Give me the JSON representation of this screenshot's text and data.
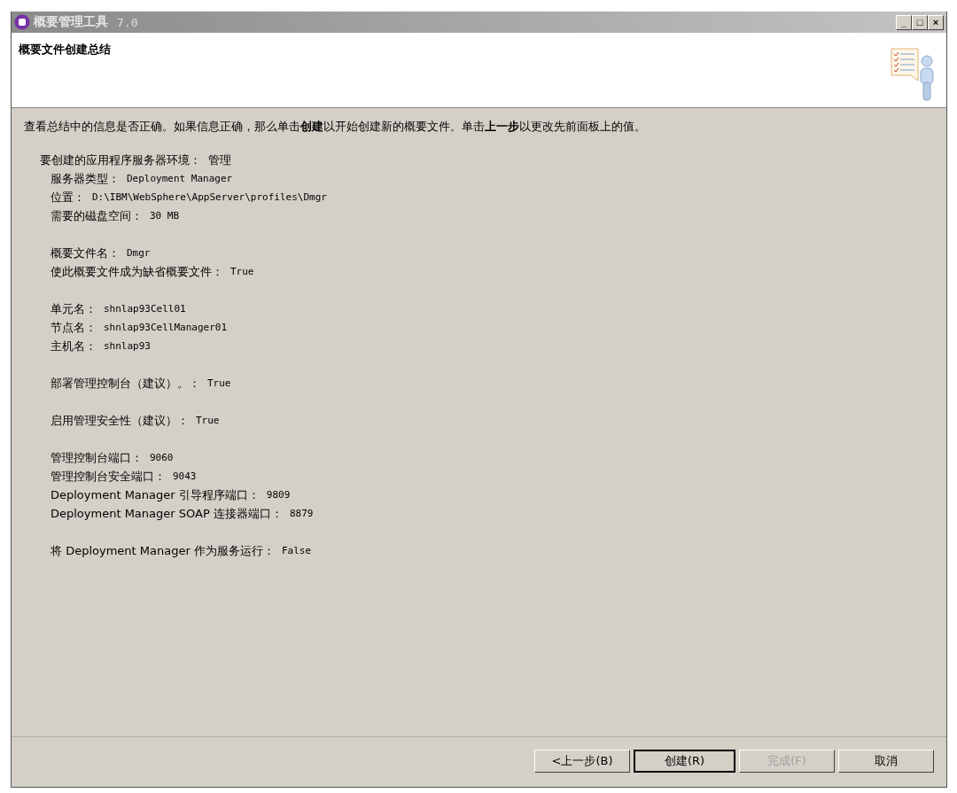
{
  "window": {
    "title": "概要管理工具",
    "version": "7.0",
    "controls": [
      "_",
      "□",
      "×"
    ]
  },
  "header": {
    "title": "概要文件创建总结"
  },
  "instruction": "查看总结中的信息是否正确。如果信息正确，那么单击**创建**以开始创建新的概要文件。单击**上一步**以更改先前面板上的值。",
  "summary": {
    "heading": {
      "label": "要创建的应用程序服务器环境：",
      "value": "管理"
    },
    "groups": [
      [
        {
          "label": "服务器类型：",
          "value": "Deployment Manager"
        },
        {
          "label": "位置：",
          "value": "D:\\IBM\\WebSphere\\AppServer\\profiles\\Dmgr"
        },
        {
          "label": "需要的磁盘空间：",
          "value": "30 MB"
        }
      ],
      [
        {
          "label": "概要文件名：",
          "value": "Dmgr"
        },
        {
          "label": "使此概要文件成为缺省概要文件：",
          "value": "True"
        }
      ],
      [
        {
          "label": "单元名：",
          "value": "shnlap93Cell01"
        },
        {
          "label": "节点名：",
          "value": "shnlap93CellManager01"
        },
        {
          "label": "主机名：",
          "value": "shnlap93"
        }
      ],
      [
        {
          "label": "部署管理控制台（建议）。：",
          "value": "True"
        }
      ],
      [
        {
          "label": "启用管理安全性（建议）：",
          "value": "True"
        }
      ],
      [
        {
          "label": "管理控制台端口：",
          "value": "9060"
        },
        {
          "label": "管理控制台安全端口：",
          "value": "9043"
        },
        {
          "label": "Deployment Manager 引导程序端口：",
          "value": "9809"
        },
        {
          "label": "Deployment Manager SOAP 连接器端口：",
          "value": "8879"
        }
      ],
      [
        {
          "label": "将 Deployment Manager 作为服务运行：",
          "value": "False"
        }
      ]
    ]
  },
  "buttons": [
    {
      "label": "<上一步(B)",
      "disabled": false,
      "default": false
    },
    {
      "label": "创建(R)",
      "disabled": false,
      "default": true
    },
    {
      "label": "完成(F)",
      "disabled": true,
      "default": false
    },
    {
      "label": "取消",
      "disabled": false,
      "default": false
    }
  ]
}
